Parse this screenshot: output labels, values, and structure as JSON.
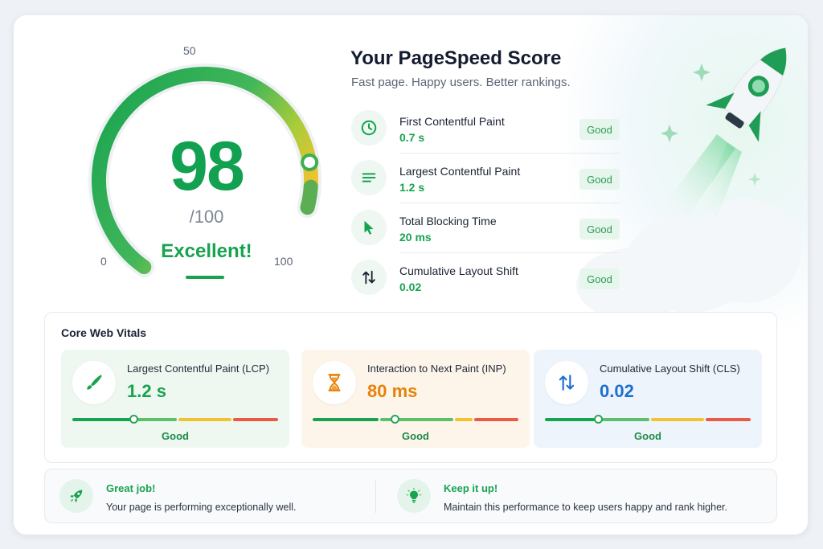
{
  "gauge": {
    "score": "98",
    "max_label": "/100",
    "rating": "Excellent!",
    "score_fraction": 0.98,
    "ticks": {
      "min": "0",
      "mid": "50",
      "max": "100"
    }
  },
  "header": {
    "title": "Your PageSpeed Score",
    "subtitle": "Fast page. Happy users. Better rankings."
  },
  "metrics": [
    {
      "icon": "clock-icon",
      "name": "First Contentful Paint",
      "value": "0.7 s",
      "badge": "Good"
    },
    {
      "icon": "lines-icon",
      "name": "Largest Contentful Paint",
      "value": "1.2 s",
      "badge": "Good"
    },
    {
      "icon": "cursor-icon",
      "name": "Total Blocking Time",
      "value": "20 ms",
      "badge": "Good"
    },
    {
      "icon": "arrows-updown-icon",
      "name": "Cumulative Layout Shift",
      "value": "0.02",
      "badge": "Good"
    }
  ],
  "core_web_vitals": {
    "title": "Core Web Vitals",
    "items": [
      {
        "icon": "brush-icon",
        "name": "Largest Contentful Paint (LCP)",
        "value": "1.2 s",
        "status": "Good",
        "level": 0.3,
        "accent": "#17a34f",
        "bg": "#eef8f1"
      },
      {
        "icon": "hourglass-icon",
        "name": "Interaction to Next Paint (INP)",
        "value": "80 ms",
        "status": "Good",
        "level": 0.4,
        "accent": "#e6820a",
        "bg": "#fdf5e9"
      },
      {
        "icon": "arrows-updown-icon",
        "name": "Cumulative Layout Shift (CLS)",
        "value": "0.02",
        "status": "Good",
        "level": 0.26,
        "accent": "#1c6fd1",
        "bg": "#eef4fb"
      }
    ]
  },
  "tips": [
    {
      "icon": "rocket-icon",
      "title": "Great job!",
      "text": "Your page is performing exceptionally well."
    },
    {
      "icon": "lightbulb-icon",
      "title": "Keep it up!",
      "text": "Maintain this performance to keep users happy and rank higher."
    }
  ],
  "colors": {
    "good": "#17a34f",
    "warn": "#f2c230",
    "poor": "#ea5a45",
    "good_light": "#5cc06a"
  }
}
